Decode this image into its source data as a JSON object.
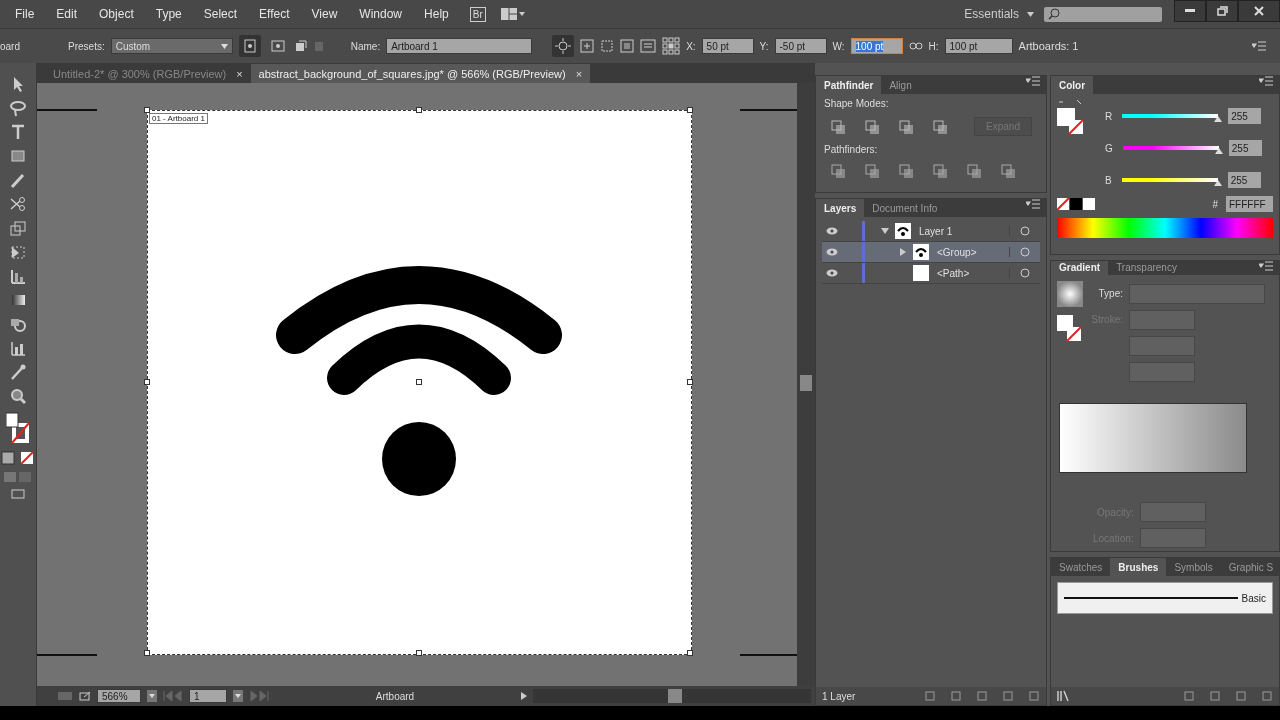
{
  "menu_bar": {
    "items": [
      "File",
      "Edit",
      "Object",
      "Type",
      "Select",
      "Effect",
      "View",
      "Window",
      "Help"
    ],
    "bridge": "Br",
    "workspace": "Essentials"
  },
  "control_bar": {
    "cut_label": "oard",
    "presets_label": "Presets:",
    "presets_value": "Custom",
    "name_label": "Name:",
    "name_value": "Artboard 1",
    "fields": [
      {
        "label": "X:",
        "value": "50 pt",
        "selected": false
      },
      {
        "label": "Y:",
        "value": "-50 pt",
        "selected": false
      },
      {
        "label": "W:",
        "value": "100 pt",
        "selected": true
      },
      {
        "label": "H:",
        "value": "100 pt",
        "selected": false
      }
    ],
    "artboards": "Artboards: 1"
  },
  "document_tabs": [
    {
      "title": "Untitled-2* @ 300% (RGB/Preview)",
      "close": "×",
      "selected": false
    },
    {
      "title": "abstract_background_of_squares.jpg* @ 566% (RGB/Preview)",
      "close": "×",
      "selected": true
    }
  ],
  "artboard": {
    "label": "01 - Artboard 1"
  },
  "status_bar": {
    "zoom": "566%",
    "page": "1",
    "label": "Artboard"
  },
  "pathfinder_panel": {
    "tabs": [
      {
        "label": "Pathfinder",
        "selected": true
      },
      {
        "label": "Align",
        "selected": false
      }
    ],
    "shape_modes_label": "Shape Modes:",
    "expand_button": "Expand",
    "pathfinders_label": "Pathfinders:"
  },
  "layers_panel": {
    "tabs": [
      {
        "label": "Layers",
        "selected": true
      },
      {
        "label": "Document Info",
        "selected": false
      }
    ],
    "layers": [
      {
        "name": "Layer 1",
        "expanded": true,
        "selected": false,
        "children": [
          {
            "name": "<Group>",
            "expanded": false,
            "selected": true
          },
          {
            "name": "<Path>",
            "selected": false
          }
        ]
      }
    ],
    "footer": "1 Layer"
  },
  "color_panel": {
    "tabs": [
      {
        "label": "Color",
        "selected": true
      }
    ],
    "channels": [
      {
        "name": "R",
        "value": "255",
        "level": 1,
        "color": "#00ffff"
      },
      {
        "name": "G",
        "value": "255",
        "level": 1,
        "color": "#ff00ff"
      },
      {
        "name": "B",
        "value": "255",
        "level": 1,
        "color": "#ffff00"
      }
    ],
    "hex_label": "#",
    "hex": "FFFFFF"
  },
  "gradient_panel": {
    "tabs": [
      {
        "label": "Gradient",
        "selected": true
      },
      {
        "label": "Transparency",
        "selected": false
      }
    ],
    "type_label": "Type:",
    "stroke_label": "Stroke:",
    "opacity_label": "Opacity:",
    "location_label": "Location:"
  },
  "brushes_panel": {
    "tabs": [
      {
        "label": "Swatches",
        "selected": false
      },
      {
        "label": "Brushes",
        "selected": true
      },
      {
        "label": "Symbols",
        "selected": false
      },
      {
        "label": "Graphic S",
        "selected": false
      }
    ],
    "brushes": [
      {
        "name": "Basic",
        "selected": true
      }
    ]
  }
}
